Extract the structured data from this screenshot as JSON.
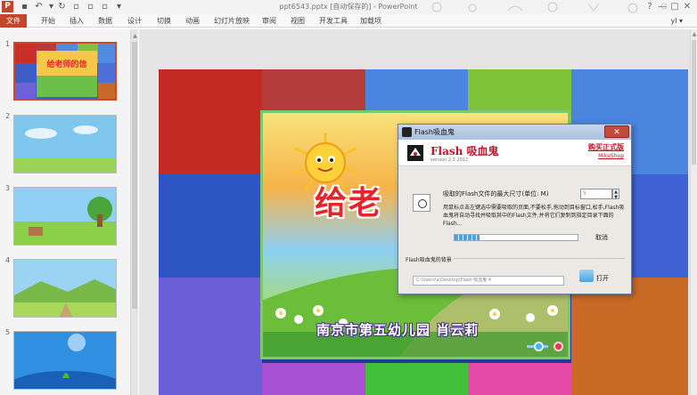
{
  "window": {
    "title": "ppt6543.pptx [自动保存的] - PowerPoint",
    "user": "yl ▾",
    "controls": [
      "?",
      "—",
      "□",
      "✕"
    ]
  },
  "ribbon": {
    "file_tab": "文件",
    "tabs": [
      "开始",
      "插入",
      "数据",
      "设计",
      "切换",
      "动画",
      "幻灯片放映",
      "审阅",
      "视图",
      "开发工具",
      "加载项"
    ]
  },
  "thumbnails": [
    {
      "number": "1",
      "selected": true
    },
    {
      "number": "2",
      "selected": false
    },
    {
      "number": "3",
      "selected": false
    },
    {
      "number": "4",
      "selected": false
    },
    {
      "number": "5",
      "selected": false
    }
  ],
  "slide": {
    "title_text": "给老",
    "footer_text": "南京市第五幼儿园 肖云莉"
  },
  "dialog": {
    "title": "Flash吸血鬼",
    "app_name": "Flash 吸血鬼",
    "version": "version 2.3 2012",
    "official_link": "购买正式版",
    "official_sub": "MikeShop",
    "size_label": "吸取的Flash文件的最大尺寸(单位: M)",
    "size_value": "5",
    "description": "用鼠标点击左键选中需要吸取的页面,不要松手,拖动到目标窗口,松手,Flash吸血鬼将自动寻找并吸取其中的Flash文件,并将它们复制到指定目录下面的Flash...",
    "progress": 0.2,
    "cancel_label": "取消",
    "group_label": "Flash吸血鬼的背景",
    "path_value": "C:\\Users\\a\\Desktop\\Flash 吸血鬼 4",
    "open_label": "打开"
  }
}
